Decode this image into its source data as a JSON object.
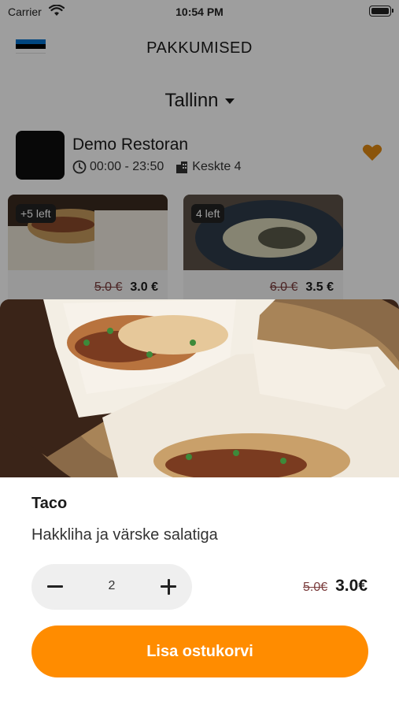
{
  "status_bar": {
    "carrier": "Carrier",
    "time": "10:54 PM"
  },
  "nav": {
    "title": "PAKKUMISED"
  },
  "city": {
    "name": "Tallinn"
  },
  "restaurant": {
    "name": "Demo Restoran",
    "hours": "00:00 - 23:50",
    "address": "Keskte 4"
  },
  "offers": [
    {
      "badge": "+5 left",
      "old_price": "5.0 €",
      "price": "3.0 €"
    },
    {
      "badge": "4 left",
      "old_price": "6.0 €",
      "price": "3.5 €"
    }
  ],
  "sheet": {
    "title": "Taco",
    "description": "Hakkliha ja värske salatiga",
    "quantity": "2",
    "old_price": "5.0€",
    "price": "3.0€",
    "cta": "Lisa ostukorvi"
  },
  "colors": {
    "accent": "#ff8c00",
    "heart": "#e08a12",
    "flag": [
      "#0072ce",
      "#000000",
      "#ffffff"
    ]
  }
}
